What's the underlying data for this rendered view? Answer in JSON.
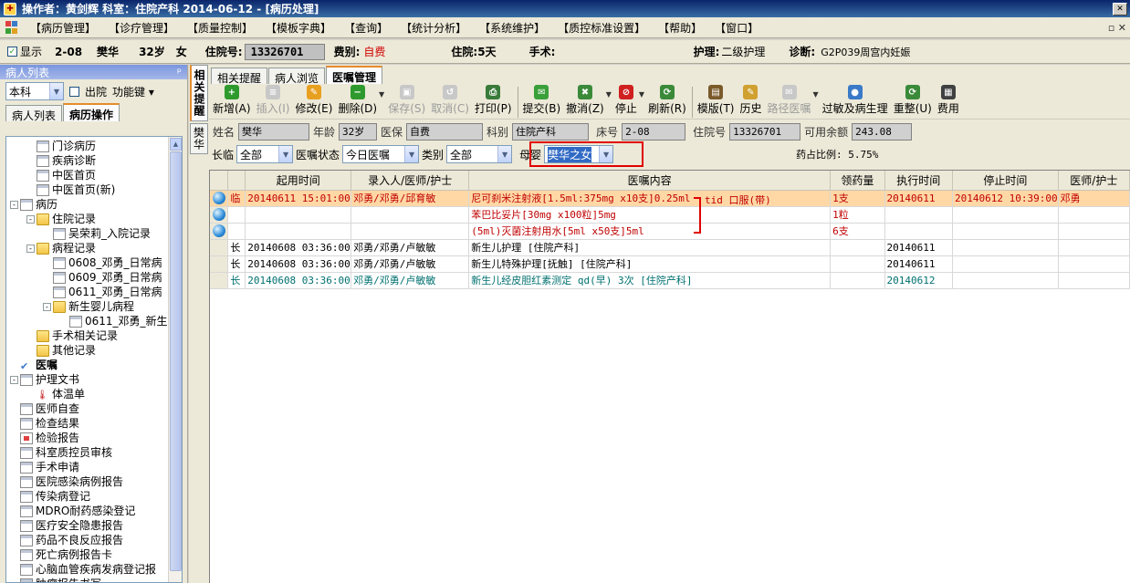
{
  "titlebar": {
    "text": "操作者：黄剑辉   科室：住院产科   2014-06-12 - [病历处理]"
  },
  "menu": [
    "【病历管理】",
    "【诊疗管理】",
    "【质量控制】",
    "【模板字典】",
    "【查询】",
    "【统计分析】",
    "【系统维护】",
    "【质控标准设置】",
    "【帮助】",
    "【窗口】"
  ],
  "infobar": {
    "show_label": "显示",
    "bed": "2-08",
    "name": "樊华",
    "age": "32岁",
    "sex": "女",
    "admission_label": "住院号:",
    "admission_no": "13326701",
    "fee_label": "费别:",
    "fee": "自费",
    "stay": "住院:5天",
    "surgery_label": "手术:",
    "nursing_label": "护理:",
    "nursing": "二级护理",
    "diag_label": "诊断:",
    "diag": "G2P039周宫内妊娠"
  },
  "left": {
    "header": "病人列表",
    "pin": "ᵖ",
    "dept": "本科",
    "discharge": "出院",
    "func": "功能键",
    "tabs": [
      "病人列表",
      "病历操作"
    ],
    "tree": [
      {
        "t": "门诊病历",
        "lv": 1,
        "ic": "doc"
      },
      {
        "t": "疾病诊断",
        "lv": 1,
        "ic": "doc"
      },
      {
        "t": "中医首页",
        "lv": 1,
        "ic": "doc"
      },
      {
        "t": "中医首页(新)",
        "lv": 1,
        "ic": "doc"
      },
      {
        "t": "病历",
        "lv": 0,
        "ic": "doc",
        "exp": "-"
      },
      {
        "t": "住院记录",
        "lv": 1,
        "ic": "folder",
        "exp": "-"
      },
      {
        "t": "吴荣莉_入院记录",
        "lv": 2,
        "ic": "doc"
      },
      {
        "t": "病程记录",
        "lv": 1,
        "ic": "folder",
        "exp": "-"
      },
      {
        "t": "0608_邓勇_日常病",
        "lv": 2,
        "ic": "doc"
      },
      {
        "t": "0609_邓勇_日常病",
        "lv": 2,
        "ic": "doc"
      },
      {
        "t": "0611_邓勇_日常病",
        "lv": 2,
        "ic": "doc"
      },
      {
        "t": "新生婴儿病程",
        "lv": 2,
        "ic": "folder",
        "exp": "-"
      },
      {
        "t": "0611_邓勇_新生",
        "lv": 3,
        "ic": "doc"
      },
      {
        "t": "手术相关记录",
        "lv": 1,
        "ic": "folder"
      },
      {
        "t": "其他记录",
        "lv": 1,
        "ic": "folder"
      },
      {
        "t": "医嘱",
        "lv": 0,
        "ic": "check",
        "bold": true
      },
      {
        "t": "护理文书",
        "lv": 0,
        "ic": "doc",
        "exp": "-"
      },
      {
        "t": "体温单",
        "lv": 1,
        "ic": "therm"
      },
      {
        "t": "医师自查",
        "lv": 0,
        "ic": "doc"
      },
      {
        "t": "检查结果",
        "lv": 0,
        "ic": "doc"
      },
      {
        "t": "检验报告",
        "lv": 0,
        "ic": "red"
      },
      {
        "t": "科室质控员审核",
        "lv": 0,
        "ic": "doc"
      },
      {
        "t": "手术申请",
        "lv": 0,
        "ic": "doc"
      },
      {
        "t": "医院感染病例报告",
        "lv": 0,
        "ic": "doc"
      },
      {
        "t": "传染病登记",
        "lv": 0,
        "ic": "doc"
      },
      {
        "t": "MDRO耐药感染登记",
        "lv": 0,
        "ic": "doc"
      },
      {
        "t": "医疗安全隐患报告",
        "lv": 0,
        "ic": "doc"
      },
      {
        "t": "药品不良反应报告",
        "lv": 0,
        "ic": "doc"
      },
      {
        "t": "死亡病例报告卡",
        "lv": 0,
        "ic": "doc"
      },
      {
        "t": "心脑血管疾病发病登记报",
        "lv": 0,
        "ic": "doc"
      },
      {
        "t": "肿瘤报告书写",
        "lv": 0,
        "ic": "doc"
      }
    ]
  },
  "vtabs": [
    "相关提醒",
    "樊华"
  ],
  "main": {
    "tabs": [
      "相关提醒",
      "病人浏览",
      "医嘱管理"
    ],
    "toolbar": [
      {
        "label": "新增(A)",
        "color": "#2e9a2e",
        "g": "+"
      },
      {
        "label": "插入(I)",
        "color": "#c8c8c8",
        "dis": true,
        "g": "≡"
      },
      {
        "label": "修改(E)",
        "color": "#e8a020",
        "g": "✎"
      },
      {
        "label": "删除(D)",
        "color": "#2e9a2e",
        "g": "−",
        "dd": true
      },
      {
        "label": "保存(S)",
        "color": "#c8c8c8",
        "dis": true,
        "g": "▣"
      },
      {
        "label": "取消(C)",
        "color": "#c8c8c8",
        "dis": true,
        "g": "↺"
      },
      {
        "label": "打印(P)",
        "color": "#3a7a3a",
        "g": "⎙",
        "sep": true
      },
      {
        "label": "提交(B)",
        "color": "#3aa03a",
        "g": "✉"
      },
      {
        "label": "撤消(Z)",
        "color": "#3a8a3a",
        "g": "✖",
        "dd": true
      },
      {
        "label": "停止",
        "color": "#d02020",
        "g": "⊘",
        "dd": true
      },
      {
        "label": "刷新(R)",
        "color": "#3a8a3a",
        "g": "⟳",
        "sep": true
      },
      {
        "label": "模版(T)",
        "color": "#7a5a2a",
        "g": "▤"
      },
      {
        "label": "历史",
        "color": "#d0a030",
        "g": "✎"
      },
      {
        "label": "路径医嘱",
        "color": "#c8c8c8",
        "dis": true,
        "g": "✉",
        "dd": true
      },
      {
        "label": "过敏及病生理",
        "color": "#3a7ac8",
        "g": "●"
      },
      {
        "label": "重整(U)",
        "color": "#3a8a3a",
        "g": "⟳"
      },
      {
        "label": "费用",
        "color": "#404040",
        "g": "▦"
      }
    ],
    "patient": {
      "name_l": "姓名",
      "name": "樊华",
      "age_l": "年龄",
      "age": "32岁",
      "ins_l": "医保",
      "ins": "自费",
      "dept_l": "科别",
      "dept": "住院产科",
      "bed_l": "床号",
      "bed": "2-08",
      "adm_l": "住院号",
      "adm": "13326701",
      "bal_l": "可用余额",
      "bal": "243.08"
    },
    "filter": {
      "long": "长临",
      "long_v": "全部",
      "status_l": "医嘱状态",
      "status_v": "今日医嘱",
      "type_l": "类别",
      "type_v": "全部",
      "mb_l": "母婴",
      "mb_v": "樊华之女",
      "ratio": "药占比例: 5.75%"
    },
    "annotation": "tid 口服(带)",
    "columns": [
      "起用时间",
      "录入人/医师/护士",
      "医嘱内容",
      "领药量",
      "执行时间",
      "停止时间",
      "医师/护士"
    ],
    "rows": [
      {
        "ball": true,
        "kind": "临",
        "start": "20140611 15:01:00",
        "who": "邓勇/邓勇/邱育敏",
        "content": "尼可刹米注射液[1.5ml:375mg x10支]0.25ml",
        "qty": "1支",
        "exec": "20140611",
        "stop": "20140612 10:39:00",
        "doc": "邓勇",
        "cls": "c-red",
        "sel": true
      },
      {
        "ball": true,
        "kind": "",
        "start": "",
        "who": "",
        "content": "苯巴比妥片[30mg x100粒]5mg",
        "qty": "1粒",
        "exec": "",
        "stop": "",
        "doc": "",
        "cls": "c-red"
      },
      {
        "ball": true,
        "kind": "",
        "start": "",
        "who": "",
        "content": "(5ml)灭菌注射用水[5ml x50支]5ml",
        "qty": "6支",
        "exec": "",
        "stop": "",
        "doc": "",
        "cls": "c-red"
      },
      {
        "ball": false,
        "kind": "长",
        "start": "20140608 03:36:00",
        "who": "邓勇/邓勇/卢敏敏",
        "content": "新生儿护理  [住院产科]",
        "qty": "",
        "exec": "20140611",
        "stop": "",
        "doc": "",
        "cls": "c-blk"
      },
      {
        "ball": false,
        "kind": "长",
        "start": "20140608 03:36:00",
        "who": "邓勇/邓勇/卢敏敏",
        "content": "新生儿特殊护理[抚触]  [住院产科]",
        "qty": "",
        "exec": "20140611",
        "stop": "",
        "doc": "",
        "cls": "c-blk"
      },
      {
        "ball": false,
        "kind": "长",
        "start": "20140608 03:36:00",
        "who": "邓勇/邓勇/卢敏敏",
        "content": "新生儿经皮胆红素测定 qd(早) 3次 [住院产科]",
        "qty": "",
        "exec": "20140612",
        "stop": "",
        "doc": "",
        "cls": "c-teal"
      }
    ]
  }
}
